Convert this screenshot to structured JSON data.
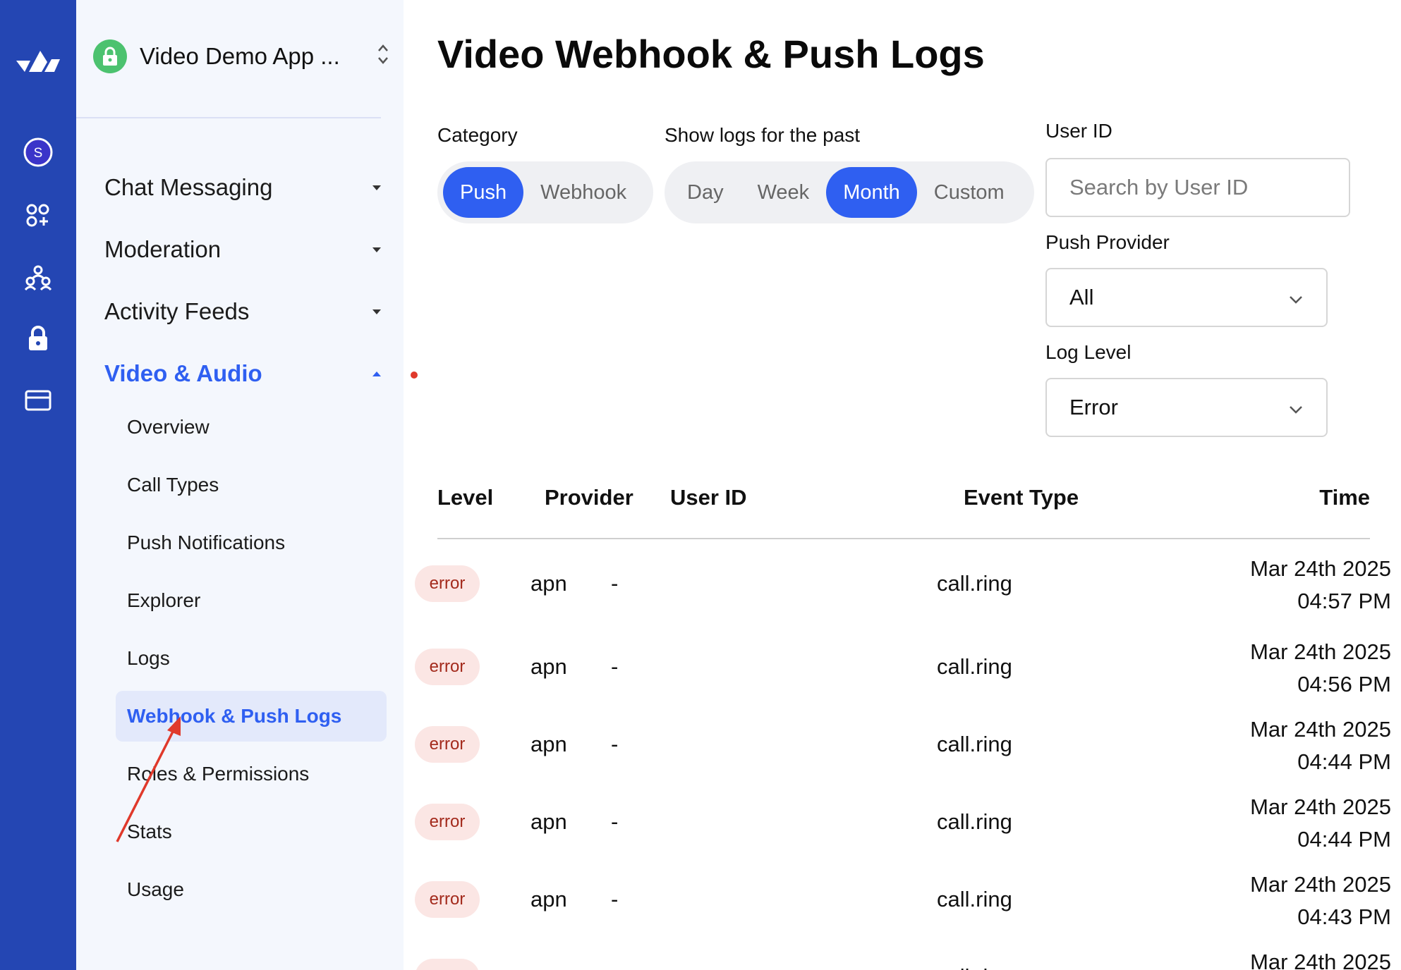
{
  "app": {
    "name": "Video Demo App ...",
    "avatar_letter": "S",
    "accent_color": "#2f5ff1",
    "rail_color": "#2446b3"
  },
  "rail_icons": [
    "logo-icon",
    "organization-avatar-icon",
    "apps-icon",
    "team-icon",
    "lock-icon",
    "billing-card-icon"
  ],
  "sidebar": {
    "sections": [
      {
        "label": "Chat Messaging",
        "expanded": false
      },
      {
        "label": "Moderation",
        "expanded": false
      },
      {
        "label": "Activity Feeds",
        "expanded": false
      },
      {
        "label": "Video & Audio",
        "expanded": true
      }
    ],
    "video_items": [
      "Overview",
      "Call Types",
      "Push Notifications",
      "Explorer",
      "Logs",
      "Webhook & Push Logs",
      "Roles & Permissions",
      "Stats",
      "Usage"
    ],
    "active_item": "Webhook & Push Logs"
  },
  "main": {
    "title": "Video Webhook & Push Logs",
    "category": {
      "label": "Category",
      "options": [
        "Push",
        "Webhook"
      ],
      "selected": "Push"
    },
    "range": {
      "label": "Show logs for the past",
      "options": [
        "Day",
        "Week",
        "Month",
        "Custom"
      ],
      "selected": "Month"
    },
    "user_id": {
      "label": "User ID",
      "placeholder": "Search by User ID",
      "value": ""
    },
    "push_provider": {
      "label": "Push Provider",
      "value": "All"
    },
    "log_level": {
      "label": "Log Level",
      "value": "Error"
    },
    "table": {
      "columns": [
        "Level",
        "Provider",
        "User ID",
        "Event Type",
        "Time"
      ],
      "rows": [
        {
          "level": "error",
          "provider": "apn",
          "user_id": "-",
          "event_type": "call.ring",
          "date": "Mar 24th 2025",
          "time": "04:57 PM"
        },
        {
          "level": "error",
          "provider": "apn",
          "user_id": "-",
          "event_type": "call.ring",
          "date": "Mar 24th 2025",
          "time": "04:56 PM"
        },
        {
          "level": "error",
          "provider": "apn",
          "user_id": "-",
          "event_type": "call.ring",
          "date": "Mar 24th 2025",
          "time": "04:44 PM"
        },
        {
          "level": "error",
          "provider": "apn",
          "user_id": "-",
          "event_type": "call.ring",
          "date": "Mar 24th 2025",
          "time": "04:44 PM"
        },
        {
          "level": "error",
          "provider": "apn",
          "user_id": "-",
          "event_type": "call.ring",
          "date": "Mar 24th 2025",
          "time": "04:43 PM"
        },
        {
          "level": "error",
          "provider": "apn",
          "user_id": "-",
          "event_type": "call.ring",
          "date": "Mar 24th 2025",
          "time": ""
        }
      ]
    }
  },
  "annotations": {
    "arrow_color": "#e0392b"
  }
}
